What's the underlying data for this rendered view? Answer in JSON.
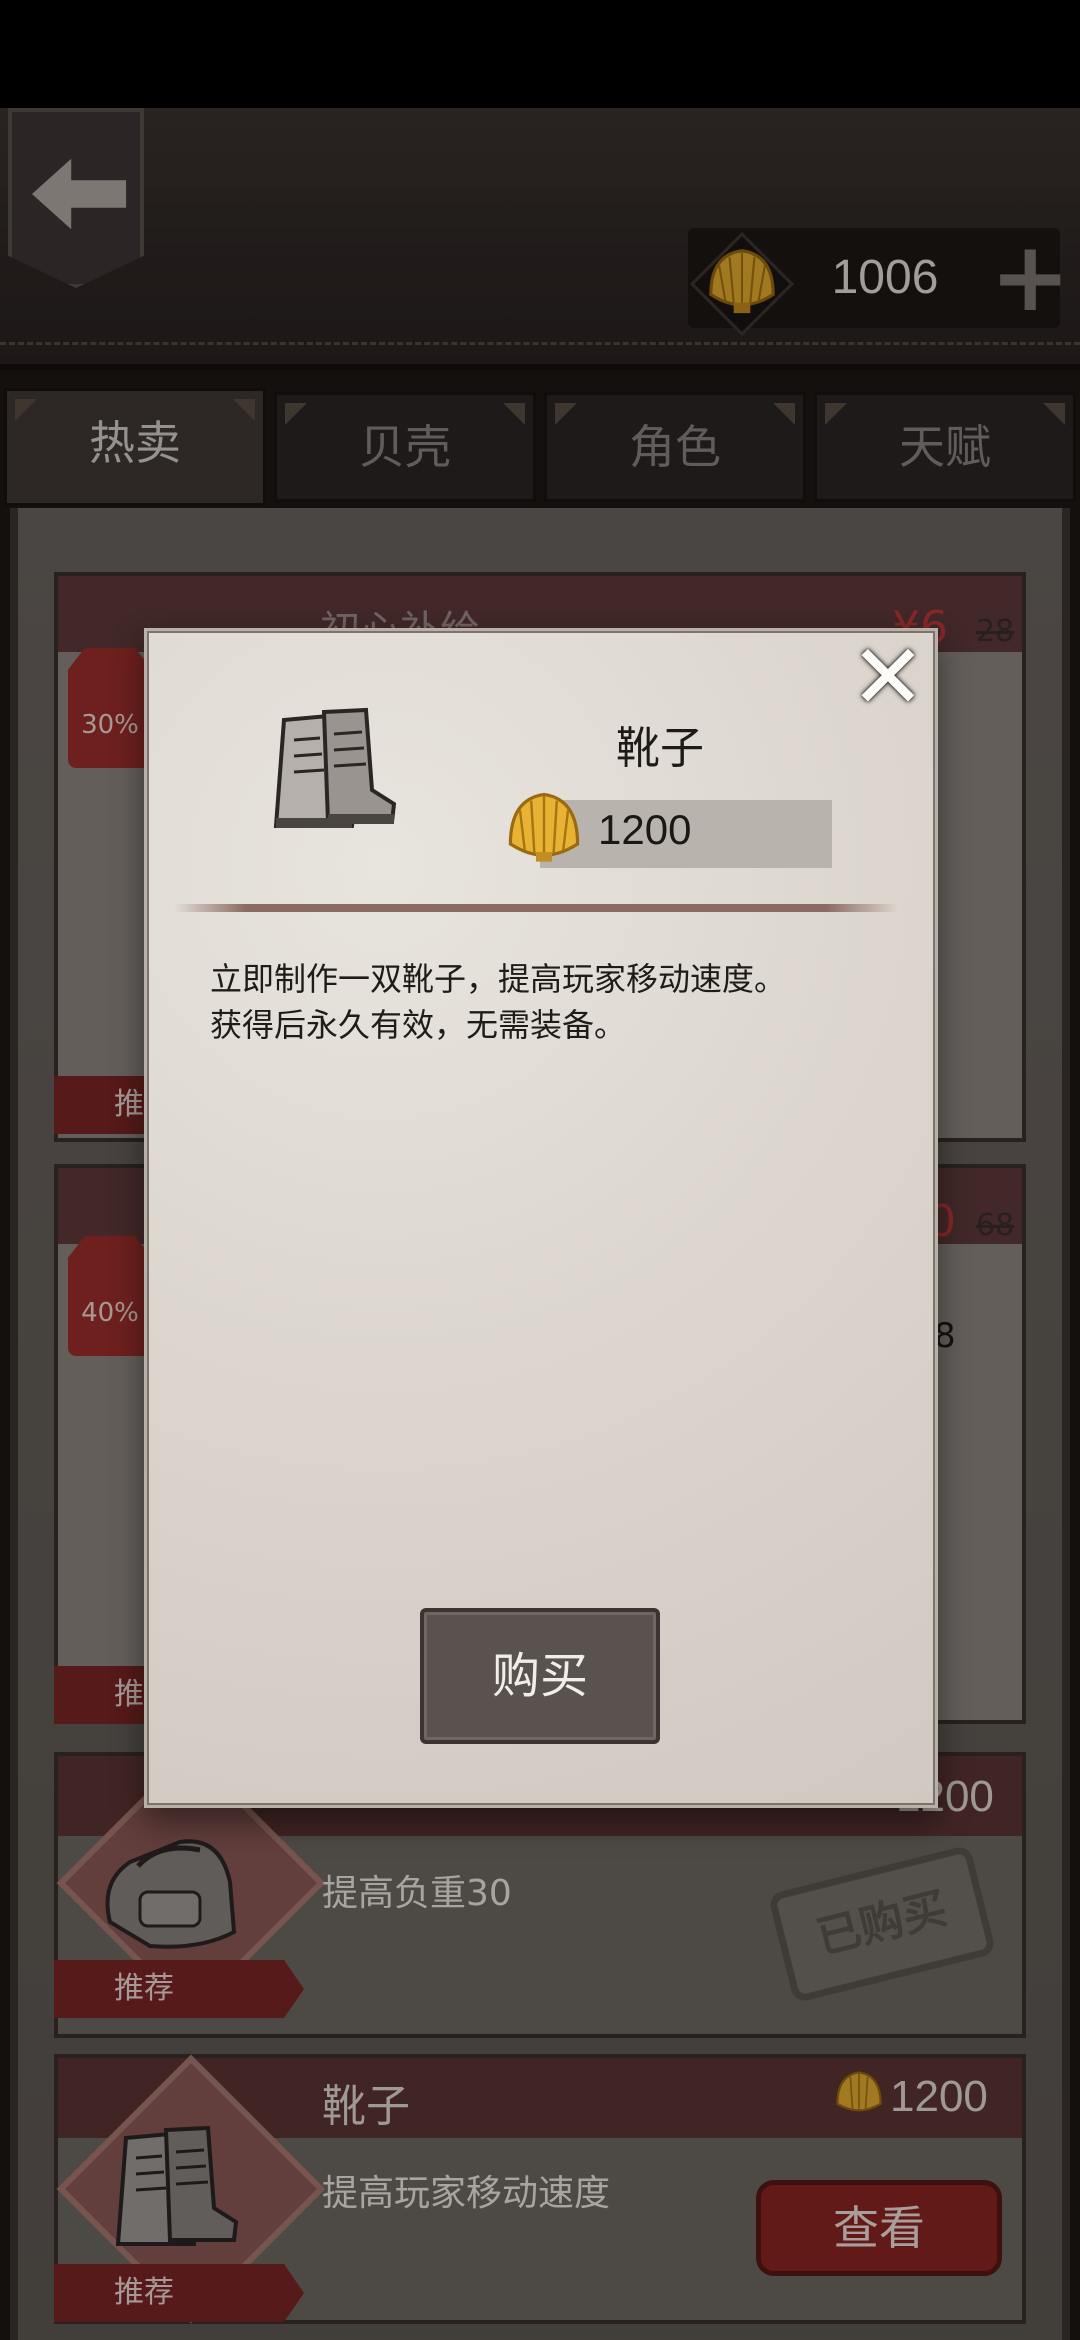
{
  "header": {
    "currency_value": "1006",
    "currency_icon": "shell-icon",
    "back_icon": "arrow-left-icon",
    "plus_icon": "plus-icon"
  },
  "tabs": [
    {
      "label": "热卖",
      "active": true
    },
    {
      "label": "贝壳",
      "active": false
    },
    {
      "label": "角色",
      "active": false
    },
    {
      "label": "天赋",
      "active": false
    }
  ],
  "cards": [
    {
      "title": "初心补给",
      "discount": "30%",
      "price": "¥6",
      "original_price": "28",
      "ribbon": "推荐"
    },
    {
      "discount": "40%",
      "price": "0",
      "original_price": "68",
      "side_value": "8",
      "ribbon": "推荐"
    }
  ],
  "items": [
    {
      "price": "1200",
      "desc": "提高负重30",
      "ribbon": "推荐",
      "stamp": "已购买"
    },
    {
      "name": "靴子",
      "price": "1200",
      "desc": "提高玩家移动速度",
      "ribbon": "推荐",
      "button": "查看"
    }
  ],
  "modal": {
    "name": "靴子",
    "price": "1200",
    "desc_line1": "立即制作一双靴子，提高玩家移动速度。",
    "desc_line2": "获得后永久有效，无需装备。",
    "buy_label": "购买",
    "close_icon": "close-icon"
  },
  "colors": {
    "accent_red": "#8d2624",
    "shell_gold": "#e0a92b",
    "parchment": "#dcd6cf"
  }
}
